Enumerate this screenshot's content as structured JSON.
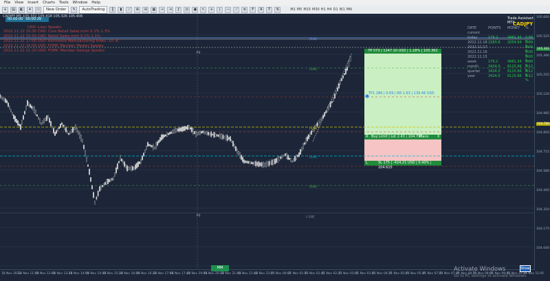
{
  "menu": {
    "items": [
      "File",
      "View",
      "Insert",
      "Charts",
      "Tools",
      "Window",
      "Help"
    ]
  },
  "toolbar": {
    "new_order": "New Order",
    "autotrading": "AutoTrading",
    "timeframes": [
      "M1",
      "M5",
      "M15",
      "M30",
      "H1",
      "H4",
      "D1",
      "W1",
      "MN"
    ]
  },
  "chart": {
    "symbol_info": "CADJPY,M5  105.332 105.418 105.326 105.406",
    "clock": {
      "left": "00:00:00",
      "right": "00:00:39"
    }
  },
  "news": [
    {
      "text": "2022.11.22 15:30  CAD: Core Retail Sales m/m         0.1%   1.3%"
    },
    {
      "text": "2022.11.22 15:30  CAD: Retail Sales m/m               0.1%   1.1%"
    },
    {
      "text": "2022.11.22 17:00  USD: Richmond Manufacturing Index   -10    -8"
    },
    {
      "text": "2022.11.22 19:00  USD: FOMC Member Mester Speaks"
    },
    {
      "text": "2022.11.22 21:10  USD: FOMC Member George Speaks"
    }
  ],
  "news_top_partial": "USD: Loan Speaks",
  "price_axis": [
    "105.660",
    "105.525",
    "105.390",
    "105.255",
    "105.120",
    "104.985",
    "104.850",
    "104.715",
    "104.580",
    "104.445",
    "104.310",
    "104.175",
    "104.040"
  ],
  "time_axis": [
    "18 Nov 2022",
    "18 Nov 11:05",
    "18 Nov 12:05",
    "18 Nov 13:25",
    "18 Nov 14:05",
    "18 Nov 14:45",
    "18 Nov 15:25",
    "18 Nov 16:05",
    "18 Nov 16:25",
    "18 Nov 17:05",
    "18 Nov 17:45",
    "18 Nov 19:05",
    "18 Nov 20:25",
    "18 Nov 21:05",
    "18 Nov 21:45",
    "18 Nov 23:05",
    "21 Nov 00:05",
    "21 Nov 01:05",
    "21 Nov 01:45",
    "21 Nov 02:25",
    "21 Nov 03:05",
    "21 Nov 03:45",
    "21 Nov 04:25",
    "21 Nov 05:05",
    "21 Nov 05:45",
    "21 Nov 07:05",
    "21 Nov 07:45",
    "21 Nov 08:25",
    "21 Nov 09:05",
    "21 Nov 09:45",
    "21 Nov 10:25",
    "21 Nov 11:05"
  ],
  "levels": {
    "l1": "[4/8]",
    "l2": "[3/8]",
    "l3": "[2/8]",
    "l4": "[1/8]",
    "l5": "[0/8]",
    "l6": "[-1/8]",
    "pivot": "P1"
  },
  "trade": {
    "tp": "TP 573 | 1247.10 USD | 1.18% | 105.362",
    "tp1": "TP1 286 | 0.69 | RR 1.63 | 139.46 USD",
    "entry_r": "R",
    "entry": "Buy Limit | Lot 2.43 | 104.790",
    "place": "Place",
    "entry_x": "X",
    "sl_l": "L",
    "sl": "SL 175 | -424.21 USD | 0.40% | 104.615"
  },
  "entry_tag": "104.789",
  "sell_line_label": "105.362",
  "stats": {
    "title": "Trade Assistant MT4",
    "pair": "CADJPY",
    "headers": [
      "DATE",
      "POINTS",
      "MONEY",
      "%"
    ],
    "rows": [
      {
        "a": "current",
        "b": "",
        "c": "",
        "d": ""
      },
      {
        "a": "today",
        "b": "179.2",
        "c": "4981.34",
        "d": "0.89 %"
      },
      {
        "a": "2022.11.18",
        "b": "2283.8",
        "c": "2054.64",
        "d": "0.89 %"
      },
      {
        "a": "2022.11.17",
        "b": "",
        "c": "",
        "d": "0.00 %"
      },
      {
        "a": "2022.11.16",
        "b": "",
        "c": "",
        "d": "0.00 %"
      },
      {
        "a": "2022.11.15",
        "b": "",
        "c": "",
        "d": "0.00 %"
      },
      {
        "a": "week",
        "b": "179.2",
        "c": "4981.34",
        "d": "0.89 %"
      },
      {
        "a": "month",
        "b": "3424.0",
        "c": "6115.66",
        "d": "6.12 %"
      },
      {
        "a": "quarter",
        "b": "3424.0",
        "c": "6115.66",
        "d": "6.12 %"
      },
      {
        "a": "year",
        "b": "3424.0",
        "c": "6115.66",
        "d": "6.12 %"
      }
    ]
  },
  "mm_button": "MM",
  "show_button": "Show",
  "watermark": {
    "title": "Activate Windows",
    "sub": "Go to PC settings to activate Windows."
  },
  "colors": {
    "bg": "#1c2638",
    "grid": "#2c3a52",
    "tp_zone": "#c9efc2",
    "sl_zone": "#f6c4c4",
    "candle": "#d9d9d9"
  }
}
